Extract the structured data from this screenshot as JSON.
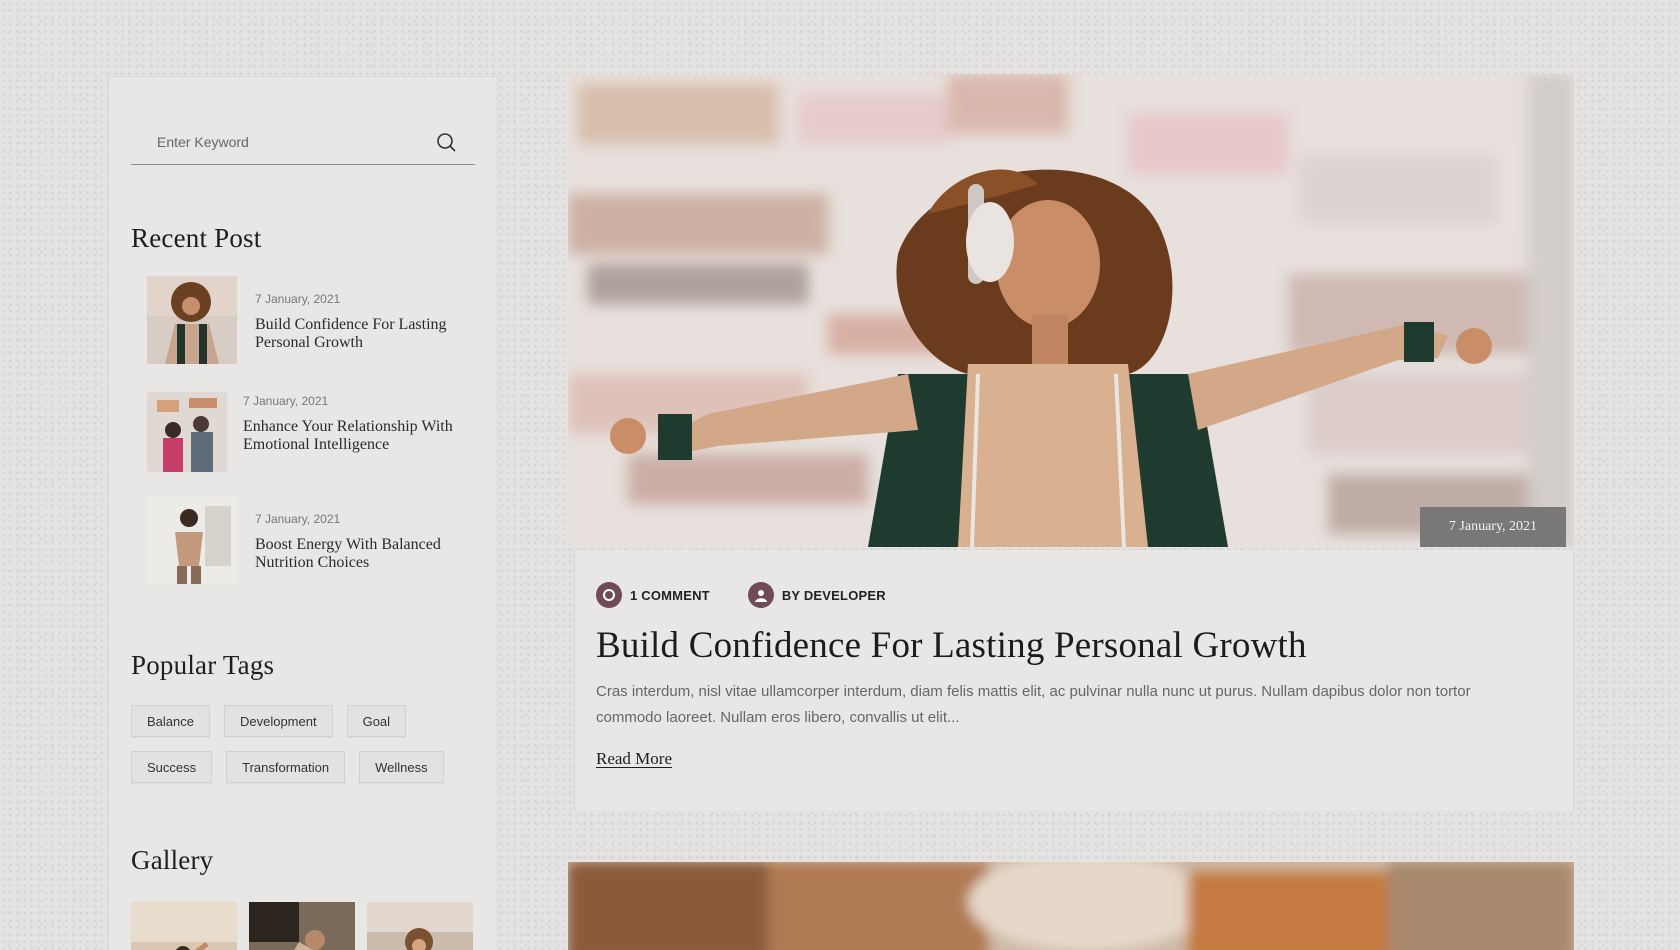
{
  "search": {
    "placeholder": "Enter Keyword"
  },
  "sidebar": {
    "recent_title": "Recent Post",
    "recent_posts": [
      {
        "date": "7 January, 2021",
        "title": "Build Confidence For Lasting Personal Growth"
      },
      {
        "date": "7 January, 2021",
        "title": "Enhance Your Relationship With Emotional Intelligence"
      },
      {
        "date": "7 January, 2021",
        "title": "Boost Energy With Balanced Nutrition Choices"
      }
    ],
    "tags_title": "Popular Tags",
    "tags": [
      "Balance",
      "Development",
      "Goal",
      "Success",
      "Transformation",
      "Wellness"
    ],
    "gallery_title": "Gallery"
  },
  "post": {
    "date": "7 January, 2021",
    "comments": "1 COMMENT",
    "author": "BY DEVELOPER",
    "title": "Build Confidence For Lasting Personal Growth",
    "excerpt": "Cras interdum, nisl vitae ullamcorper interdum, diam felis mattis elit, ac pulvinar nulla nunc ut purus. Nullam dapibus dolor non tortor commodo laoreet. Nullam eros libero, convallis ut elit...",
    "read_more": "Read More"
  },
  "colors": {
    "accent": "#6f4a57",
    "badge": "#7a7876",
    "panel": "#e8e7e5"
  },
  "icons": {
    "search": "search-icon",
    "comment": "comment-icon",
    "author": "user-icon"
  }
}
